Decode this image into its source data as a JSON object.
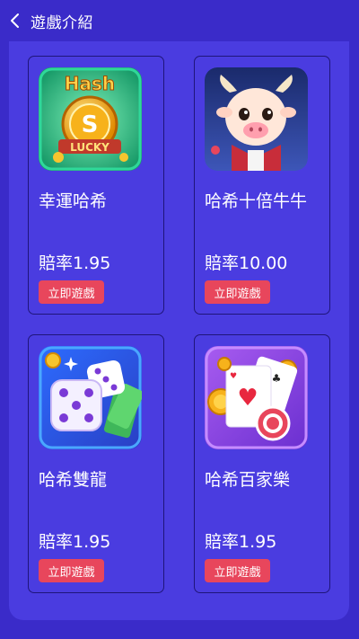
{
  "header": {
    "title": "遊戲介紹"
  },
  "games": [
    {
      "name": "幸運哈希",
      "odds": "賠率1.95",
      "button": "立即遊戲",
      "logo_text_top": "Hash",
      "logo_text_bottom": "LUCKY"
    },
    {
      "name": "哈希十倍牛牛",
      "odds": "賠率10.00",
      "button": "立即遊戲"
    },
    {
      "name": "哈希雙龍",
      "odds": "賠率1.95",
      "button": "立即遊戲"
    },
    {
      "name": "哈希百家樂",
      "odds": "賠率1.95",
      "button": "立即遊戲"
    }
  ],
  "colors": {
    "background": "#3a2bc9",
    "panel": "#4a3ce0",
    "button": "#e8465c",
    "card_border": "#1f157a"
  }
}
